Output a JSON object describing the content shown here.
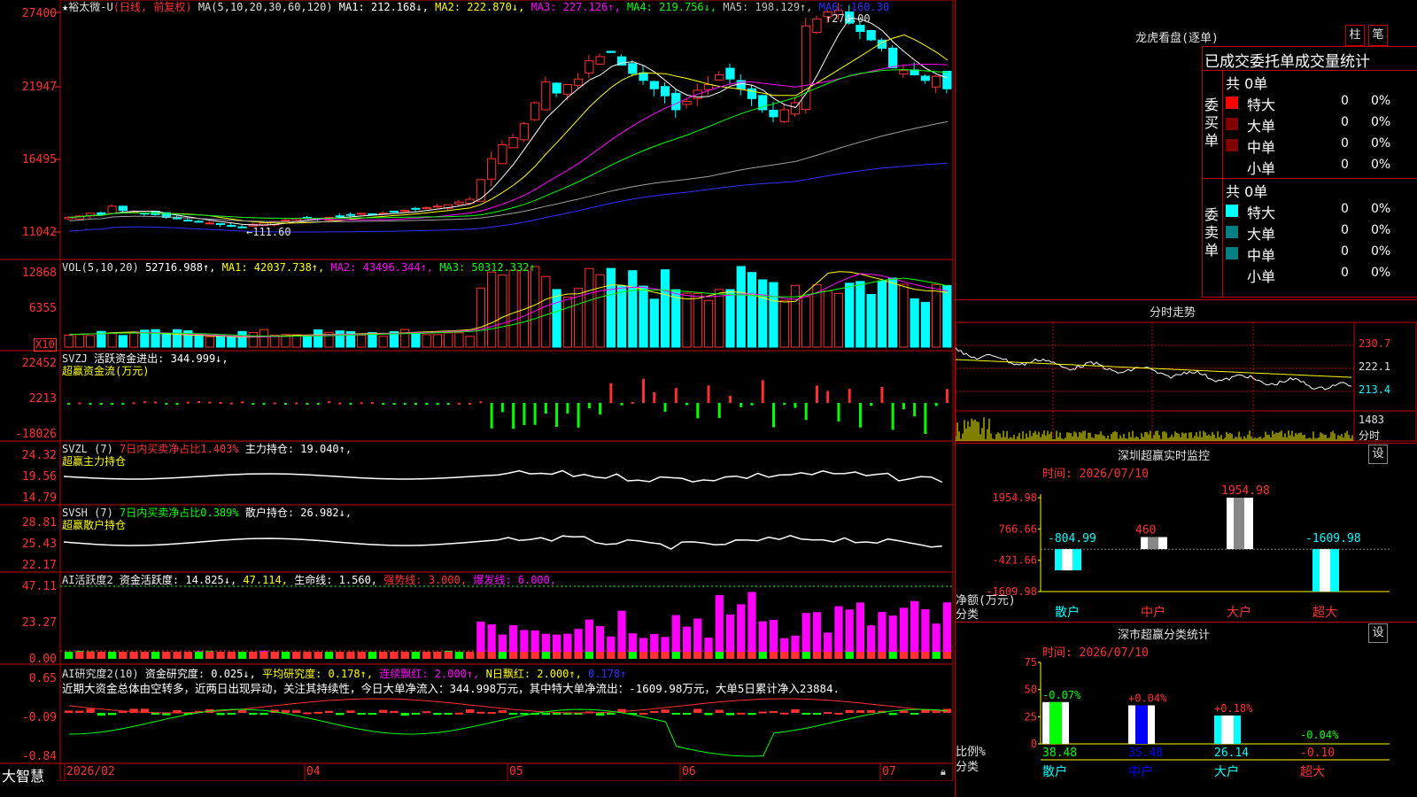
{
  "colors": {
    "up": "#ff3030",
    "down": "#00ffff",
    "ma1": "#ffffff",
    "ma2": "#ffff00",
    "ma3": "#ff00ff",
    "ma4": "#00ff00",
    "ma5": "#a0a0a0",
    "ma6": "#3030ff",
    "grid": "#b00000",
    "frame": "#c00000"
  },
  "header": {
    "star": "★",
    "stock": "裕太微-U",
    "period": "(日线, 前复权)",
    "ma_def": "MA(5,10,20,30,60,120)",
    "ma1": "MA1: 212.168↓,",
    "ma2": "MA2: 222.870↓,",
    "ma3": "MA3: 227.126↑,",
    "ma4": "MA4: 219.756↓,",
    "ma5": "MA5: 198.129↑,",
    "ma6": "MA6: 160.30"
  },
  "price_panel": {
    "yticks": [
      "27400",
      "21947",
      "16495",
      "11042"
    ],
    "high_label": "274.00",
    "low_label": "111.60"
  },
  "vol_panel": {
    "title": "VOL(5,10,20)",
    "vol": "52716.988↑,",
    "ma1": "MA1: 42037.738↑,",
    "ma2": "MA2: 43496.344↑,",
    "ma3": "MA3: 50312.332↑",
    "yticks": [
      "12868",
      "6355"
    ],
    "unit": "X10"
  },
  "svzj_panel": {
    "title": "SVZJ",
    "line": "活跃资金进出: 344.999↓,",
    "subtitle": "超赢资金流(万元)",
    "yticks": [
      "22452",
      "2213",
      "-18026"
    ]
  },
  "svzl_panel": {
    "title": "SVZL (7)",
    "ratio": "7日内买卖净占比1.403%",
    "hold": "主力持仓: 19.040↑,",
    "subtitle": "超赢主力持仓",
    "yticks": [
      "24.32",
      "19.56",
      "14.79"
    ]
  },
  "svsh_panel": {
    "title": "SVSH (7)",
    "ratio": "7日内买卖净占比0.389%",
    "hold": "散户持仓: 26.982↓,",
    "subtitle": "超赢散户持仓",
    "yticks": [
      "28.81",
      "25.43",
      "22.17"
    ]
  },
  "ai_active": {
    "title": "AI活跃度2",
    "a": "资金活跃度: 14.825↓,",
    "b": "47.114,",
    "c": "生命线: 1.560,",
    "d": "强势线: 3.000,",
    "e": "爆发线: 6.000,",
    "yticks": [
      "47.11",
      "23.27",
      "0.00"
    ]
  },
  "ai_research": {
    "title": "AI研究度2(10)",
    "a": "资金研究度: 0.025↓,",
    "b": "平均研究度: 0.178↑,",
    "c": "连续飘红: 2.000↑,",
    "d": "N日飘红: 2.000↑,",
    "e": "0.178↑",
    "comment": "近期大资金总体由空转多，近两日出现异动，关注其持续性，今日大单净流入：344.998万元，其中特大单净流出：-1609.98万元，大单5日累计净入23884.",
    "yticks": [
      "0.65",
      "-0.09",
      "-0.84"
    ]
  },
  "xaxis": {
    "logo": "大智慧",
    "labels": [
      "2026/02",
      "04",
      "05",
      "06",
      "07"
    ]
  },
  "right": {
    "lhb_title": "龙虎看盘(逐单)",
    "tab1": "柱",
    "tab2": "笔",
    "stat_title": "已成交委托单成交量统计",
    "buy_label": "委买单",
    "sell_label": "委卖单",
    "buy_total": "共 0单",
    "sell_total": "共 0单",
    "rows": [
      {
        "name": "特大",
        "qty": "0",
        "pct": "0%"
      },
      {
        "name": "大单",
        "qty": "0",
        "pct": "0%"
      },
      {
        "name": "中单",
        "qty": "0",
        "pct": "0%"
      },
      {
        "name": "小单",
        "qty": "0",
        "pct": "0%"
      }
    ],
    "intraday_title": "分时走势",
    "intraday_y": [
      "230.7",
      "222.1",
      "213.4",
      "1483"
    ],
    "intraday_unit": "分时",
    "monitor_title": "深圳超赢实时监控",
    "set_label": "设",
    "monitor_time": "时间: 2026/07/10",
    "monitor_y": [
      "1954.98",
      "766.66",
      "-421.66",
      "-1609.98"
    ],
    "monitor_ylabel": "净额(万元)",
    "monitor_xlabel": "分类",
    "monitor_values": [
      {
        "cat": "散户",
        "val": "-804.99"
      },
      {
        "cat": "中户",
        "val": "460"
      },
      {
        "cat": "大户",
        "val": "1954.98"
      },
      {
        "cat": "超大",
        "val": "-1609.98"
      }
    ],
    "class_title": "深市超赢分类统计",
    "class_time": "时间: 2026/07/10",
    "class_y": [
      "75",
      "50",
      "25",
      "0"
    ],
    "class_ylabel": "比例%",
    "class_xlabel": "分类",
    "class_values": [
      {
        "cat": "散户",
        "pct": "38.48",
        "chg": "-0.07%"
      },
      {
        "cat": "中户",
        "pct": "35.48",
        "chg": "+0.04%"
      },
      {
        "cat": "大户",
        "pct": "26.14",
        "chg": "+0.18%"
      },
      {
        "cat": "超大",
        "pct": "-0.10",
        "chg": "-0.04%"
      }
    ]
  },
  "chart_data": [
    {
      "type": "candlestick",
      "title": "裕太微-U (日线, 前复权)",
      "ylim": [
        110.42,
        274.0
      ],
      "high": 274.0,
      "low": 111.6,
      "close": [
        123,
        124,
        126,
        125,
        131,
        128,
        127,
        126,
        125,
        123,
        122,
        121,
        120,
        119,
        118,
        117,
        116,
        118,
        119,
        120,
        121,
        122,
        123,
        122,
        123,
        124,
        125,
        126,
        125,
        126,
        127,
        128,
        129,
        130,
        131,
        132,
        134,
        136,
        150,
        165,
        175,
        180,
        190,
        205,
        220,
        212,
        218,
        222,
        235,
        238,
        241,
        232,
        226,
        221,
        215,
        210,
        200,
        206,
        214,
        218,
        225,
        222,
        215,
        208,
        200,
        195,
        200,
        205,
        260,
        265,
        270,
        271,
        262,
        256,
        250,
        244,
        230,
        228,
        225,
        221,
        224,
        215
      ],
      "series_ma": {
        "MA1": 212.168,
        "MA2": 222.87,
        "MA3": 227.126,
        "MA4": 219.756,
        "MA5": 198.129,
        "MA6": 160.3
      }
    },
    {
      "type": "bar",
      "title": "VOL(5,10,20)",
      "ylim": [
        0,
        12868
      ],
      "last": 52716.988
    },
    {
      "type": "bar",
      "title": "SVZJ 活跃资金进出",
      "ylim": [
        -18026,
        22452
      ],
      "last": 344.999
    },
    {
      "type": "line",
      "title": "SVZL 主力持仓",
      "ylim": [
        14.79,
        24.32
      ],
      "last": 19.04
    },
    {
      "type": "line",
      "title": "SVSH 散户持仓",
      "ylim": [
        22.17,
        28.81
      ],
      "last": 26.982
    },
    {
      "type": "bar",
      "title": "AI活跃度2",
      "ylim": [
        0,
        47.11
      ],
      "last": 14.825
    },
    {
      "type": "bar",
      "title": "AI研究度2(10)",
      "ylim": [
        -0.84,
        0.65
      ],
      "last": 0.025
    },
    {
      "type": "bar",
      "title": "深圳超赢实时监控",
      "categories": [
        "散户",
        "中户",
        "大户",
        "超大"
      ],
      "values": [
        -804.99,
        460,
        1954.98,
        -1609.98
      ],
      "ylim": [
        -1609.98,
        1954.98
      ]
    },
    {
      "type": "bar",
      "title": "深市超赢分类统计",
      "categories": [
        "散户",
        "中户",
        "大户",
        "超大"
      ],
      "values": [
        38.48,
        35.48,
        26.14,
        -0.1
      ],
      "ylim": [
        0,
        75
      ]
    }
  ]
}
